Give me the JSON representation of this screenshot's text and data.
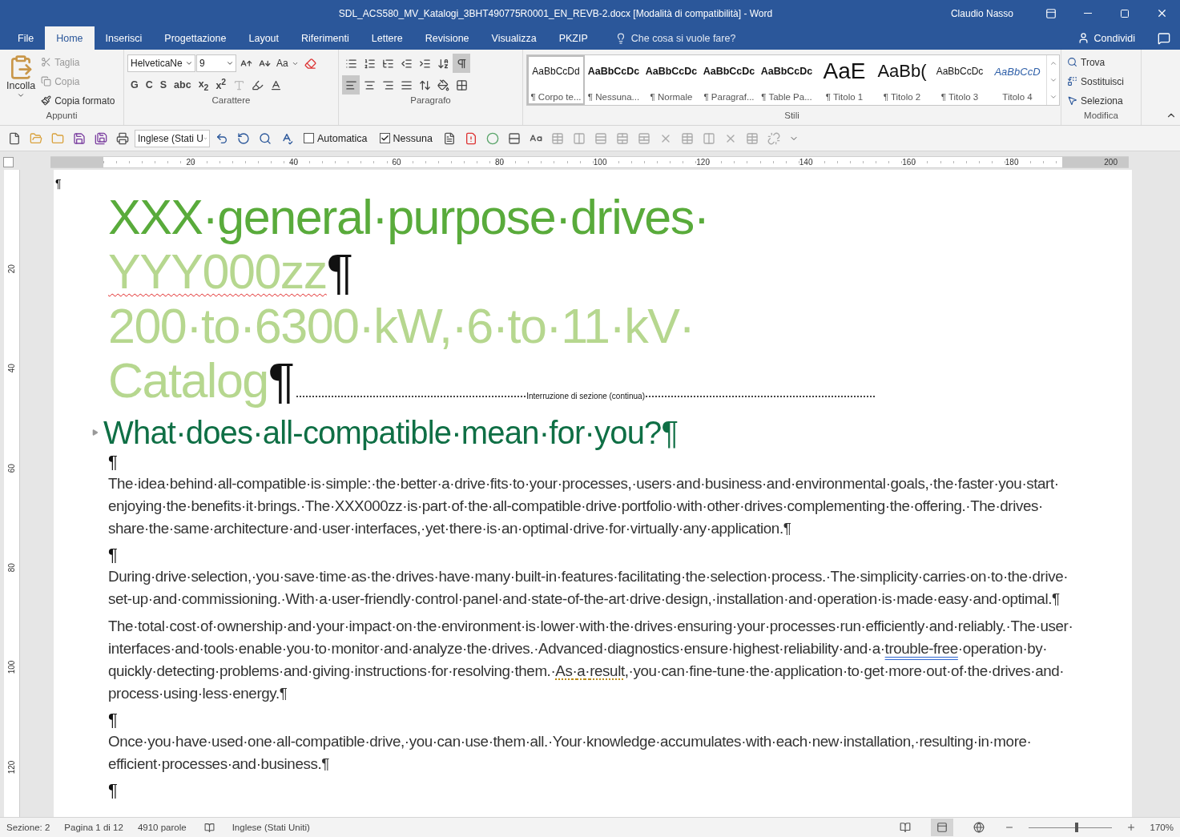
{
  "window": {
    "title": "SDL_ACS580_MV_Katalogi_3BHT490775R0001_EN_REVB-2.docx [Modalità di compatibilità]  -  Word",
    "user": "Claudio Nasso"
  },
  "menu_tabs": [
    {
      "label": "File",
      "selected": false
    },
    {
      "label": "Home",
      "selected": true
    },
    {
      "label": "Inserisci",
      "selected": false
    },
    {
      "label": "Progettazione",
      "selected": false
    },
    {
      "label": "Layout",
      "selected": false
    },
    {
      "label": "Riferimenti",
      "selected": false
    },
    {
      "label": "Lettere",
      "selected": false
    },
    {
      "label": "Revisione",
      "selected": false
    },
    {
      "label": "Visualizza",
      "selected": false
    },
    {
      "label": "PKZIP",
      "selected": false
    }
  ],
  "tell_me": "Che cosa si vuole fare?",
  "share": "Condividi",
  "clipboard": {
    "label": "Appunti",
    "paste": "Incolla",
    "items": [
      {
        "label": "Taglia",
        "disabled": true
      },
      {
        "label": "Copia",
        "disabled": true
      },
      {
        "label": "Copia formato",
        "disabled": false
      }
    ]
  },
  "font": {
    "label": "Carattere",
    "font_name": "HelveticaNe",
    "font_size": "9",
    "case_button": "Aa",
    "format_buttons": [
      "G",
      "C",
      "S",
      "abc",
      "x$_{2}$",
      "x$^{2}$"
    ]
  },
  "paragraph": {
    "label": "Paragrafo",
    "show_marks": true,
    "alignment": [
      {
        "selected": true
      },
      {
        "selected": false
      },
      {
        "selected": false
      },
      {
        "selected": false
      }
    ]
  },
  "styles": {
    "label": "Stili",
    "items": [
      {
        "preview": "AaBbCcDd",
        "name": "¶ Corpo te...",
        "kind": "plain",
        "selected": true
      },
      {
        "preview": "AaBbCcDc",
        "name": "¶ Nessuna...",
        "kind": "bold",
        "selected": false
      },
      {
        "preview": "AaBbCcDc",
        "name": "¶ Normale",
        "kind": "bold",
        "selected": false
      },
      {
        "preview": "AaBbCcDc",
        "name": "¶ Paragraf...",
        "kind": "bold",
        "selected": false
      },
      {
        "preview": "AaBbCcDc",
        "name": "¶ Table Pa...",
        "kind": "bold",
        "selected": false
      },
      {
        "preview": "AaE",
        "name": "¶ Titolo 1",
        "kind": "title1",
        "selected": false
      },
      {
        "preview": "AaBb(",
        "name": "¶ Titolo 2",
        "kind": "title2",
        "selected": false
      },
      {
        "preview": "AaBbCcDc",
        "name": "¶ Titolo 3",
        "kind": "plain",
        "selected": false
      },
      {
        "preview": "AaBbCcD",
        "name": "Titolo 4",
        "kind": "title4",
        "selected": false
      }
    ]
  },
  "editing": {
    "label": "Modifica",
    "items": [
      "Trova",
      "Sostituisci",
      "Seleziona"
    ]
  },
  "quick_toolbar": {
    "language": "Inglese (Stati U",
    "checkboxes": [
      {
        "label": "Automatica",
        "checked": false
      },
      {
        "label": "Nessuna",
        "checked": true
      }
    ]
  },
  "ruler": {
    "numbers": [
      "20",
      "40",
      "60",
      "80",
      "100",
      "120",
      "140",
      "160",
      "180",
      "200"
    ]
  },
  "vertical_ruler": {
    "numbers": [
      "20",
      "40",
      "60",
      "80",
      "100",
      "120"
    ]
  },
  "document": {
    "top_mark": "¶",
    "title_lines": [
      {
        "text": "XXX·general·purpose·drives·",
        "color": "#59ab3b",
        "spelling_error": false
      },
      {
        "text": "YYY000zz",
        "color": "#b6d78f",
        "spelling_error": true,
        "mark": "¶"
      },
      {
        "text": "200·to·6300·kW,·6·to·11·kV·",
        "color": "#b6d78f",
        "spelling_error": false
      },
      {
        "text": "Catalog",
        "color": "#b6d78f",
        "spelling_error": false,
        "mark": "¶"
      }
    ],
    "section_break": "Interruzione di sezione (continua)",
    "heading": "What·does·all-compatible·mean·for·you?¶",
    "blocks": [
      {
        "kind": "empty",
        "text": "¶"
      },
      {
        "kind": "text",
        "segments": [
          {
            "text": "The·idea·behind·all-compatible·is·simple:·the·better·a·drive·fits·to·your·processes,·users·and·business·and·environmental·goals,·the·faster·you·start·enjoying·the·benefits·it·brings.·The·XXX000zz·is·part·of·the·all-compatible·drive·portfolio·with·other·drives·complementing·the·offering.·The·drives·share·the·same·architecture·and·user·interfaces,·yet·there·is·an·optimal·drive·for·virtually·any·application.¶",
            "kind": "plain"
          }
        ]
      },
      {
        "kind": "empty",
        "text": "¶"
      },
      {
        "kind": "text",
        "segments": [
          {
            "text": "During·drive·selection,·you·save·time·as·the·drives·have·many·built-in·features·facilitating·the·selection·process.·The·simplicity·carries·on·to·the·drive·set-up·and·commissioning.·With·a·user-friendly·control·panel·and·state-of-the-art·drive·design,·installation·and·operation·is·made·easy·and·optimal.¶",
            "kind": "plain"
          }
        ]
      },
      {
        "kind": "text",
        "segments": [
          {
            "text": "The·total·cost·of·ownership·and·your·impact·on·the·environment·is·lower·with·the·drives·ensuring·your·processes·run·efficiently·and·reliably.·The·user·interfaces·and·tools·enable·you·to·monitor·and·analyze·the·drives.·Advanced·diagnostics·ensure·highest·reliability·and·a·",
            "kind": "plain"
          },
          {
            "text": "trouble-free",
            "kind": "grammar"
          },
          {
            "text": "·operation·by·quickly·detecting·problems·and·giving·instructions·for·resolving·them.·",
            "kind": "plain"
          },
          {
            "text": "As·a·result",
            "kind": "style"
          },
          {
            "text": ",·you·can·fine-tune·the·application·to·get·more·out·of·the·drives·and·process·using·less·energy.¶",
            "kind": "plain"
          }
        ]
      },
      {
        "kind": "empty",
        "text": "¶"
      },
      {
        "kind": "text",
        "segments": [
          {
            "text": "Once·you·have·used·one·all-compatible·drive,·you·can·use·them·all.·Your·knowledge·accumulates·with·each·new·installation,·resulting·in·more·efficient·processes·and·business.¶",
            "kind": "plain"
          }
        ]
      },
      {
        "kind": "empty",
        "text": "¶"
      }
    ]
  },
  "status_bar": {
    "items": [
      "Sezione: 2",
      "Pagina 1 di 12",
      "4910 parole"
    ],
    "language": "Inglese (Stati Uniti)",
    "views": [
      {
        "selected": false
      },
      {
        "selected": true
      },
      {
        "selected": false
      }
    ],
    "zoom": {
      "level": 0.58,
      "label": "170%"
    }
  }
}
